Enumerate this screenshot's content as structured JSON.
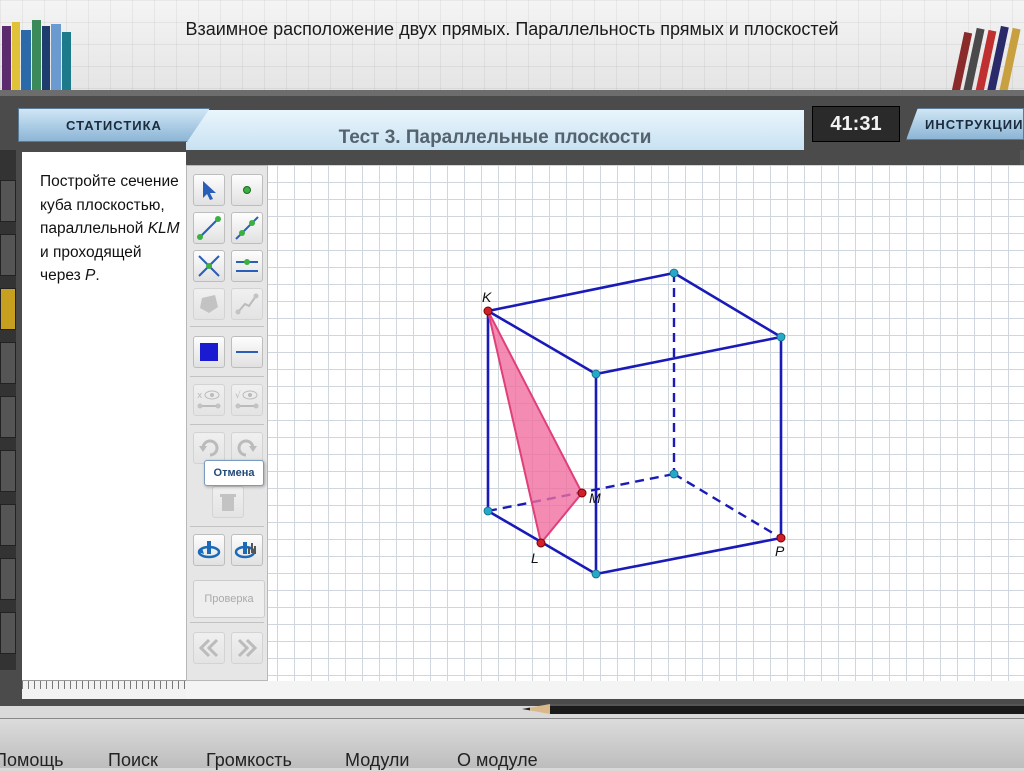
{
  "page_title": "Взаимное расположение двух прямых. Параллельность прямых и плоскостей",
  "tabs": {
    "statistics": "СТАТИСТИКА",
    "instructions": "ИНСТРУКЦИИ"
  },
  "test_title": "Тест 3. Параллельные плоскости",
  "timer": "41:31",
  "task": {
    "part1": "Постройте сечение куба плоскостью, параллельной ",
    "klm": "KLM",
    "part2": " и проходящей через ",
    "p": "P",
    "part3": "."
  },
  "tooltip": "Отмена",
  "check_button": "Проверка",
  "points": {
    "K": "K",
    "L": "L",
    "M": "M",
    "P": "P"
  },
  "colors": {
    "cube": "#1a1ab8",
    "triangle": "#f06ea0",
    "point_teal": "#28a8c8",
    "point_red": "#d0202a"
  },
  "menu": [
    "Помощь",
    "Поиск",
    "Громкость",
    "Модули",
    "О модуле"
  ]
}
